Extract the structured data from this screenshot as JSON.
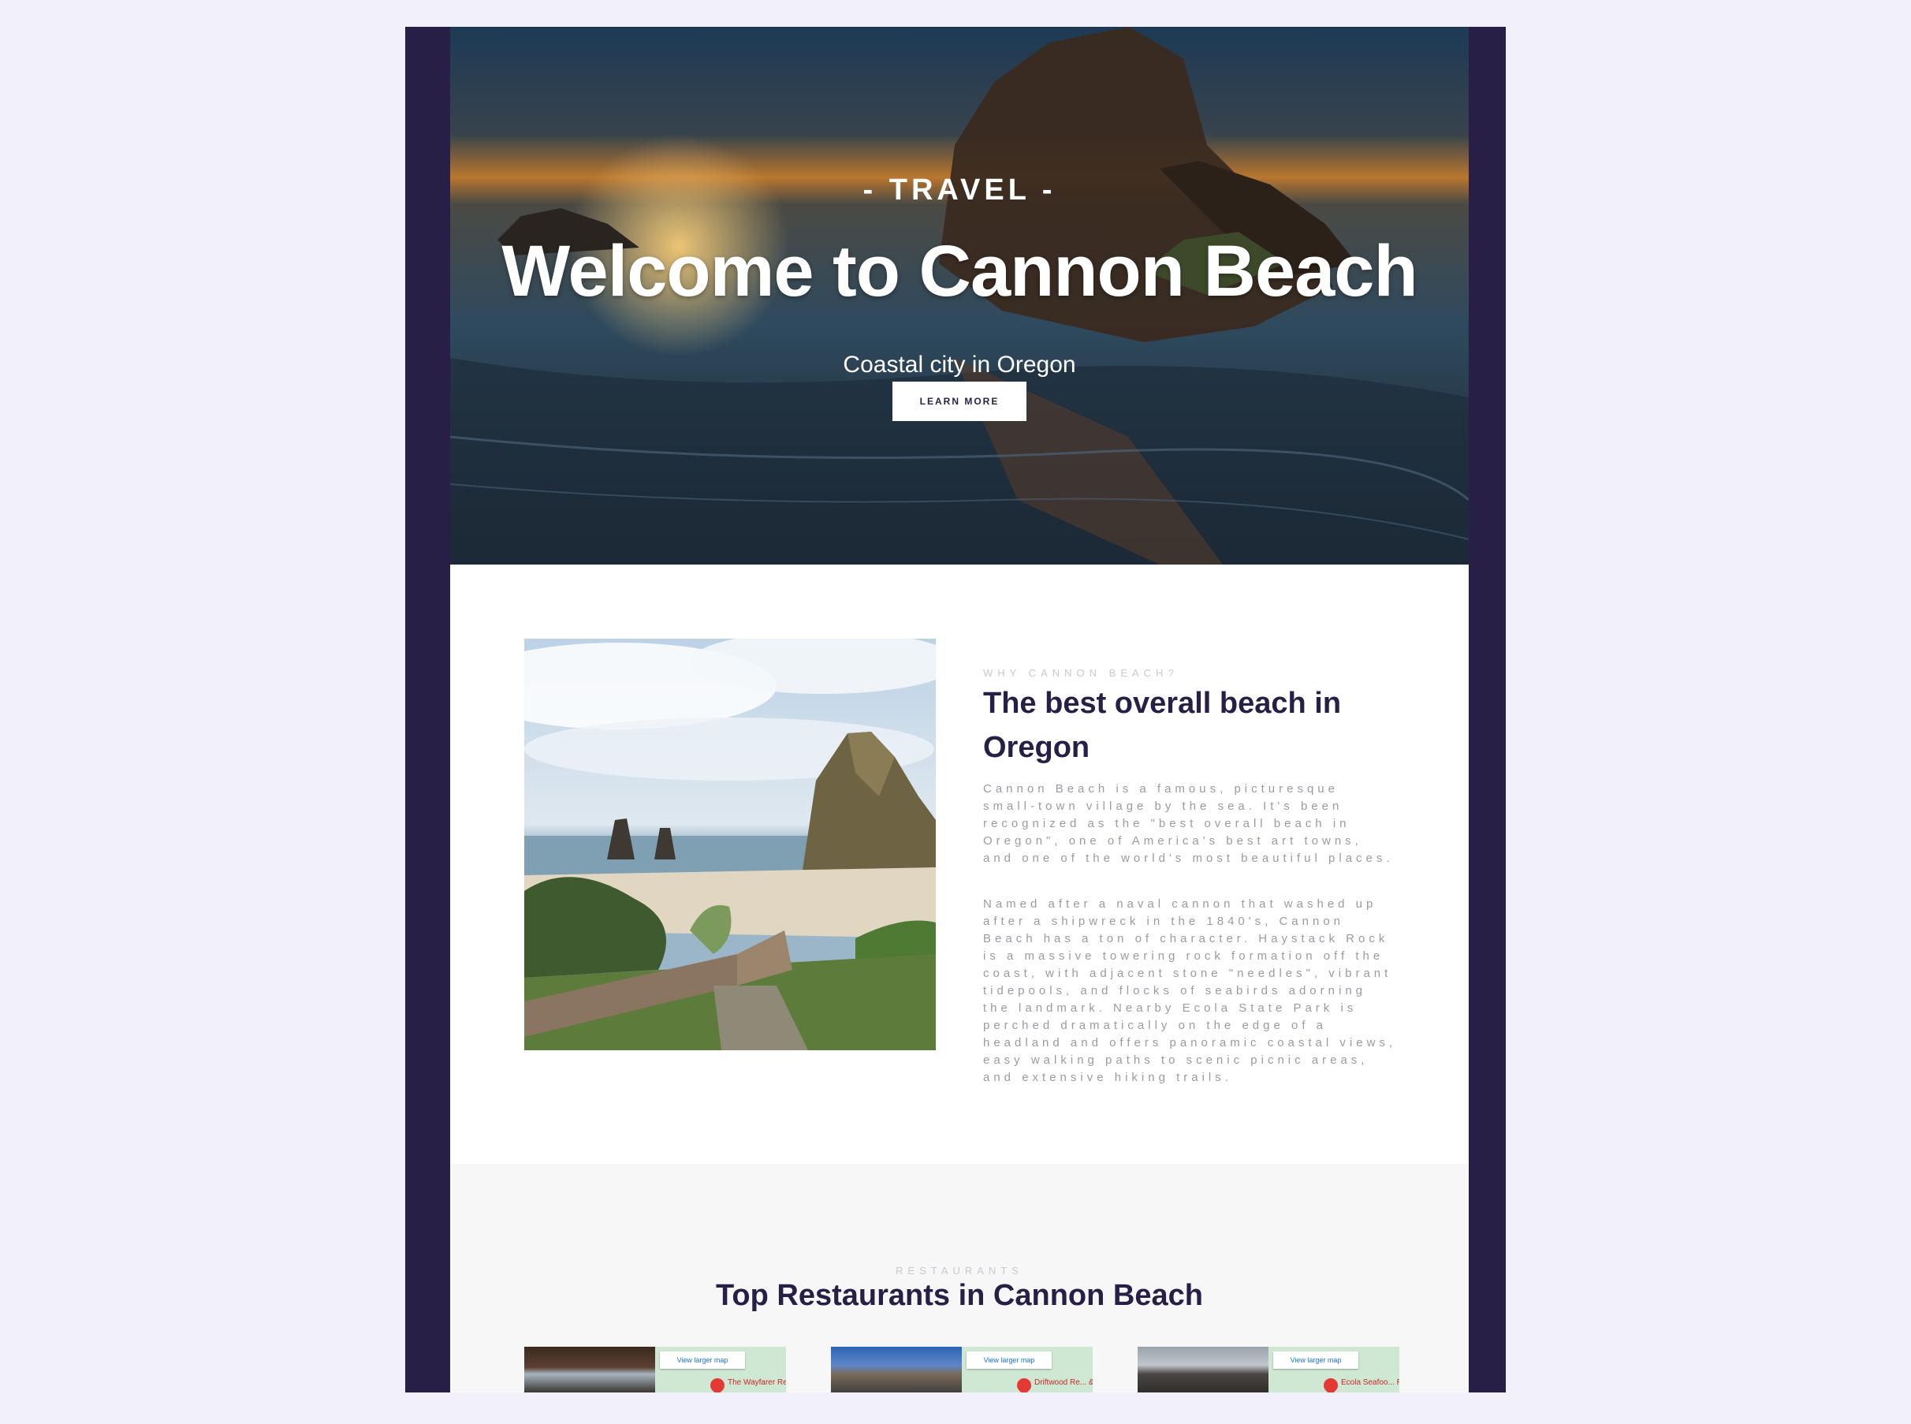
{
  "hero": {
    "eyebrow": "- TRAVEL -",
    "title": "Welcome to Cannon Beach",
    "subtitle": "Coastal city in Oregon",
    "button_label": "LEARN MORE"
  },
  "about": {
    "kicker": "WHY CANNON BEACH?",
    "title": "The best overall beach in Oregon",
    "paragraphs": [
      "Cannon Beach is a famous, picturesque small-town village by the sea. It's been recognized as the \"best overall beach in Oregon\", one of America's best art towns, and one of the world's most beautiful places.",
      "Named after a naval cannon that washed up after a shipwreck in the 1840's, Cannon Beach has a ton of character. Haystack Rock is a massive towering rock formation off the coast, with adjacent stone \"needles\", vibrant tidepools, and flocks of seabirds adorning the landmark. Nearby Ecola State Park is perched dramatically on the edge of a headland and offers panoramic coastal views, easy walking paths to scenic picnic areas, and extensive hiking trails."
    ]
  },
  "restaurants": {
    "kicker": "RESTAURANTS",
    "title": "Top Restaurants in Cannon Beach",
    "cards": [
      {
        "map_button": "View larger map",
        "map_label": "The Wayfarer Restaurant &..."
      },
      {
        "map_button": "View larger map",
        "map_label": "Driftwood Re... & Lounge"
      },
      {
        "map_button": "View larger map",
        "map_label": "Ecola Seafoo... Restaurant &..."
      }
    ]
  },
  "colors": {
    "frame": "#281f46",
    "background": "#f2f0fb",
    "heading": "#281f46",
    "body_text": "#9a99a6"
  }
}
